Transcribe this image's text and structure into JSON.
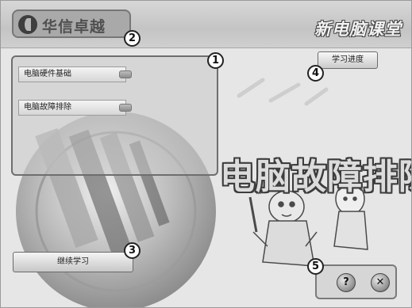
{
  "header": {
    "logo_text": "华信卓越",
    "app_title": "新电脑课堂"
  },
  "courses": [
    {
      "label": "电脑硬件基础"
    },
    {
      "label": "电脑故障排除"
    }
  ],
  "progress_button": "学习进度",
  "big_title": "电脑故障排除",
  "continue_button": "继续学习",
  "help_glyph": "?",
  "close_glyph": "✕",
  "callouts": [
    "1",
    "2",
    "3",
    "4",
    "5"
  ],
  "colors": {
    "background": "#e6e6e6",
    "header": "#c4c4c4",
    "panel_border": "#6e6e6e"
  }
}
